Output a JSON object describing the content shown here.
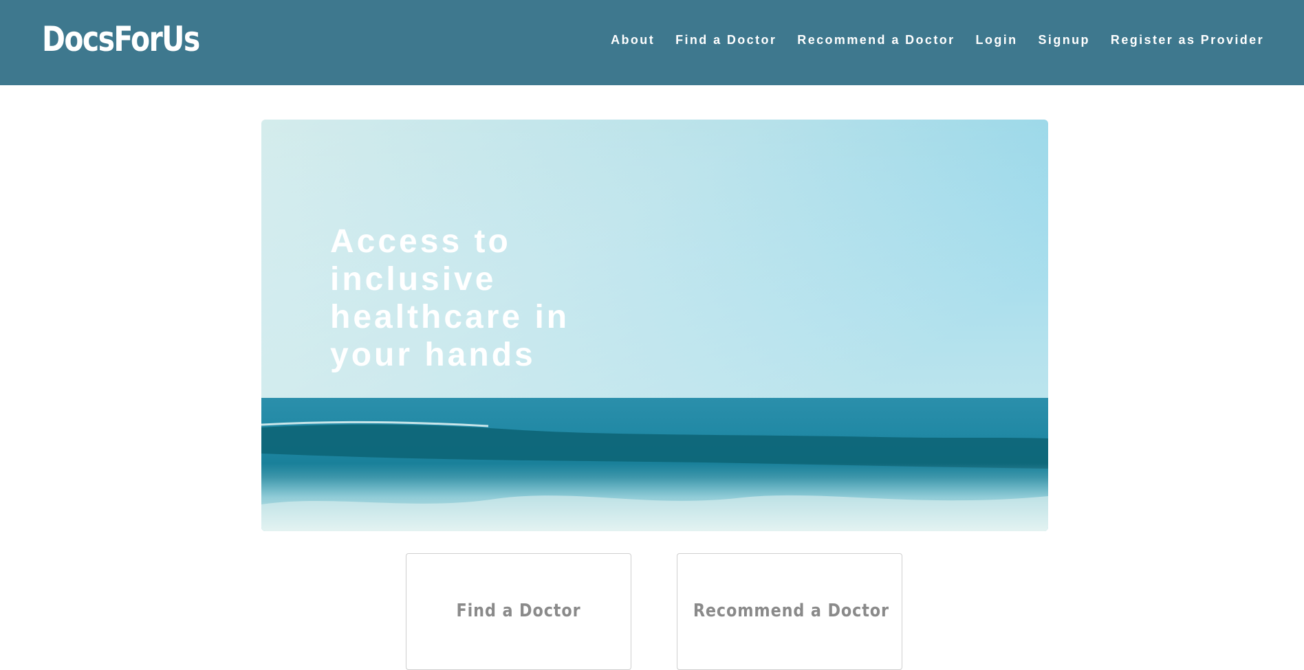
{
  "brand": {
    "name": "DocsForUs"
  },
  "nav": {
    "items": [
      {
        "label": "About"
      },
      {
        "label": "Find a Doctor"
      },
      {
        "label": "Recommend a Doctor"
      },
      {
        "label": "Login"
      },
      {
        "label": "Signup"
      },
      {
        "label": "Register as Provider"
      }
    ]
  },
  "hero": {
    "title": "Access to inclusive healthcare in your hands",
    "image": "ocean-horizon-photo"
  },
  "cards": [
    {
      "label": "Find a Doctor"
    },
    {
      "label": "Recommend a Doctor"
    }
  ],
  "colors": {
    "navbar": "#3e788e",
    "sky_top": "#8ed4e8",
    "sky_light": "#cfe9ea",
    "ocean_deep": "#1f7f99",
    "wave": "#0e6577",
    "card_text": "#8a8a8a"
  }
}
